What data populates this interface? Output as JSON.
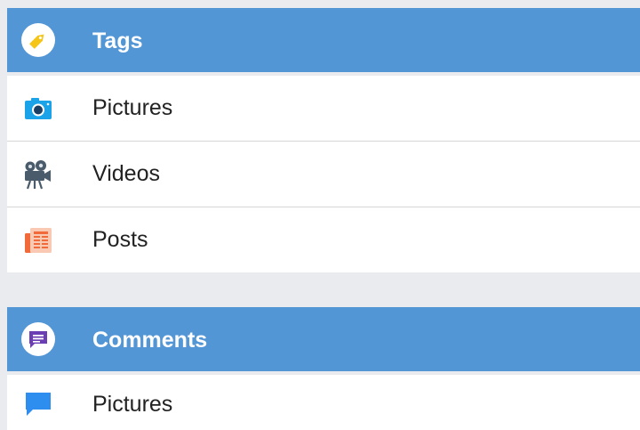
{
  "colors": {
    "header_bg": "#5396d6",
    "page_bg": "#e9ebef",
    "tag_icon": "#f5c518",
    "camera_icon": "#1aa3e8",
    "video_icon": "#4a5b6b",
    "posts_icon": "#f06a3a",
    "comment_icon": "#6b3fb3",
    "bubble_icon": "#2d8ef0"
  },
  "sections": [
    {
      "title": "Tags",
      "icon": "tag-icon",
      "items": [
        {
          "label": "Pictures",
          "icon": "camera-icon"
        },
        {
          "label": "Videos",
          "icon": "film-camera-icon"
        },
        {
          "label": "Posts",
          "icon": "newspaper-icon"
        }
      ]
    },
    {
      "title": "Comments",
      "icon": "comment-icon",
      "items": [
        {
          "label": "Pictures",
          "icon": "chat-bubble-icon"
        }
      ]
    }
  ]
}
